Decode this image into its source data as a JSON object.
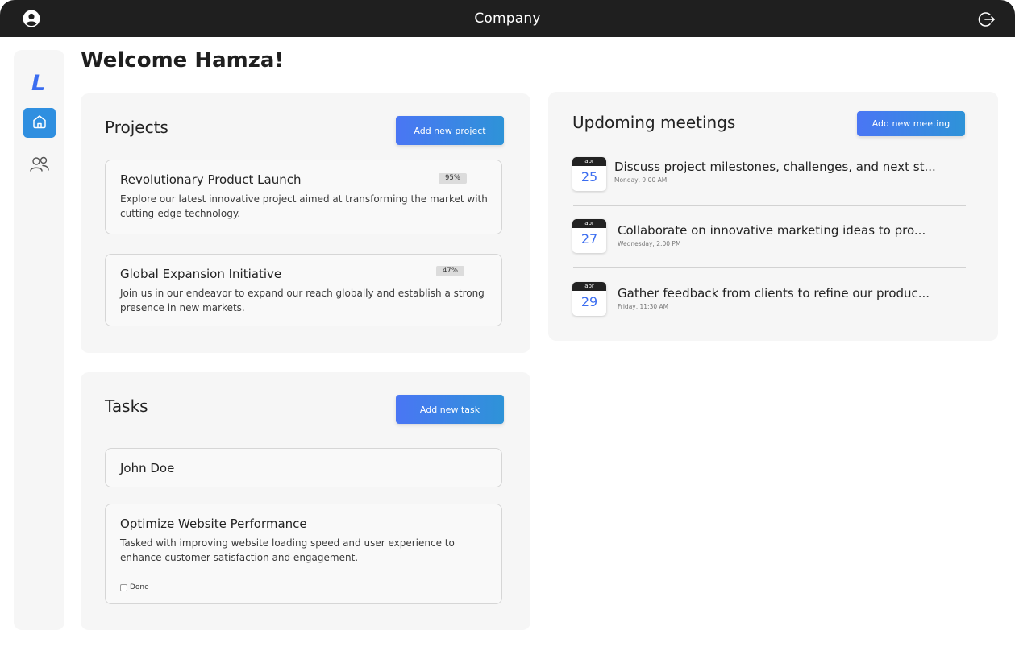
{
  "app": {
    "title": "Company"
  },
  "sidebar": {
    "logo": "L",
    "items": [
      {
        "name": "home",
        "icon": "home-icon",
        "active": true
      },
      {
        "name": "users",
        "icon": "users-icon",
        "active": false
      }
    ]
  },
  "welcome": "Welcome Hamza!",
  "projects": {
    "title": "Projects",
    "add_label": "Add new project",
    "items": [
      {
        "title": "Revolutionary Product Launch",
        "progress": "95%",
        "description": "Explore our latest innovative project aimed at transforming the market with cutting-edge technology."
      },
      {
        "title": "Global Expansion Initiative",
        "progress": "47%",
        "description": "Join us in our endeavor to expand our reach globally and establish a strong presence in new markets."
      }
    ]
  },
  "tasks": {
    "title": "Tasks",
    "add_label": "Add new task",
    "assignee": "John Doe",
    "items": [
      {
        "title": "Optimize Website Performance",
        "description": "Tasked with improving website loading speed and user experience to enhance customer satisfaction and engagement.",
        "done_label": "Done",
        "done": false
      }
    ]
  },
  "meetings": {
    "title": "Updoming meetings",
    "add_label": "Add new meeting",
    "items": [
      {
        "month": "apr",
        "day": "25",
        "title": "Discuss project milestones, challenges, and next st...",
        "time": "Monday, 9:00 AM"
      },
      {
        "month": "apr",
        "day": "27",
        "title": "Collaborate on innovative marketing ideas to pro...",
        "time": "Wednesday, 2:00 PM"
      },
      {
        "month": "apr",
        "day": "29",
        "title": "Gather feedback from clients to refine our produc...",
        "time": "Friday, 11:30 AM"
      }
    ]
  },
  "colors": {
    "topbar": "#1f1f1f",
    "accent": "#3b6df0",
    "button_gradient_start": "#4a76f4",
    "button_gradient_end": "#2e93d8",
    "panel_bg": "#f6f6f6"
  }
}
